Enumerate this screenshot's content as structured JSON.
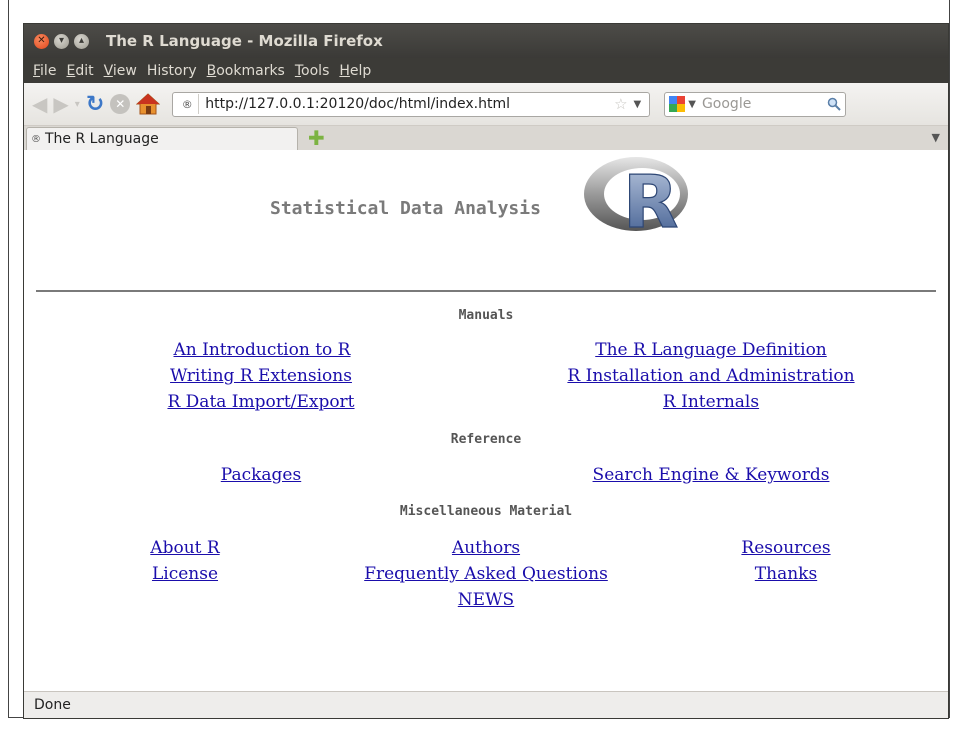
{
  "window": {
    "title": "The R Language - Mozilla Firefox"
  },
  "menu": {
    "items": [
      {
        "key": "F",
        "rest": "ile"
      },
      {
        "key": "E",
        "rest": "dit"
      },
      {
        "key": "V",
        "rest": "iew"
      },
      {
        "key": "",
        "rest": "History"
      },
      {
        "key": "B",
        "rest": "ookmarks"
      },
      {
        "key": "T",
        "rest": "ools"
      },
      {
        "key": "H",
        "rest": "elp"
      }
    ]
  },
  "navbar": {
    "url": "http://127.0.0.1:20120/doc/html/index.html",
    "search_placeholder": "Google"
  },
  "tabs": [
    {
      "label": "The R Language"
    }
  ],
  "page": {
    "site_title": "Statistical Data Analysis",
    "logo_letter": "R",
    "sections": {
      "manuals": "Manuals",
      "reference": "Reference",
      "misc": "Miscellaneous Material"
    },
    "manuals_links": {
      "intro": "An Introduction to R",
      "lang_def": "The R Language Definition",
      "extensions": "Writing R Extensions",
      "install_admin": "R Installation and Administration",
      "import_export": "R Data Import/Export",
      "internals": "R Internals"
    },
    "reference_links": {
      "packages": "Packages",
      "search": "Search Engine & Keywords"
    },
    "misc_links": {
      "about": "About R",
      "authors": "Authors",
      "resources": "Resources",
      "license": "License",
      "faq": "Frequently Asked Questions",
      "thanks": "Thanks",
      "news": "NEWS"
    }
  },
  "status": {
    "text": "Done"
  },
  "colors": {
    "link": "#1a0dab",
    "titlebar": "#3c3b37",
    "accent_close": "#e3461b"
  }
}
